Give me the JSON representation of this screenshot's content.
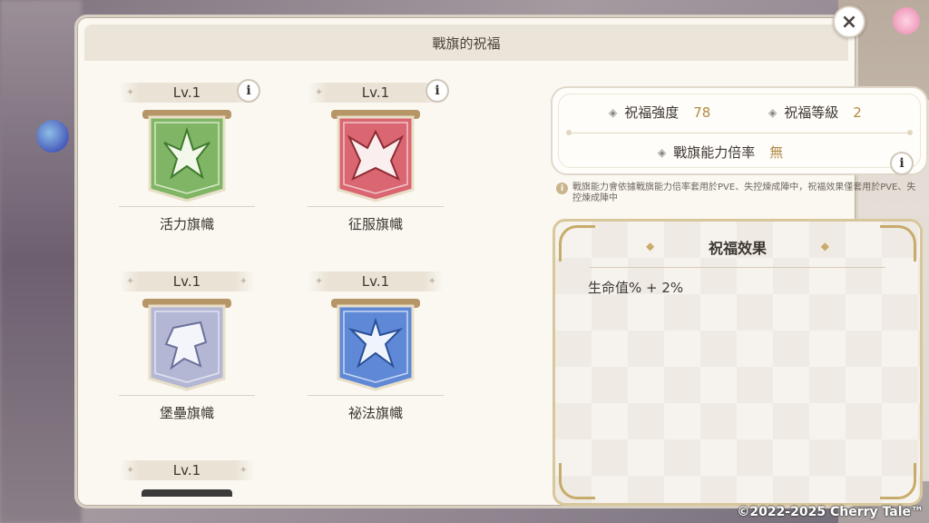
{
  "panel": {
    "title": "戰旗的祝福",
    "close_label": "×"
  },
  "banners": [
    {
      "level": "Lv.1",
      "name": "活力旗幟",
      "color": "#6aa04f",
      "emblem": "leaf-emblem-icon"
    },
    {
      "level": "Lv.1",
      "name": "征服旗幟",
      "color": "#c8505a",
      "emblem": "dragon-emblem-icon"
    },
    {
      "level": "Lv.1",
      "name": "堡壘旗幟",
      "color": "#9ea3c4",
      "emblem": "pegasus-emblem-icon"
    },
    {
      "level": "Lv.1",
      "name": "祕法旗幟",
      "color": "#4e77c4",
      "emblem": "phoenix-emblem-icon"
    },
    {
      "level": "Lv.1"
    }
  ],
  "info_label": "i",
  "stats": {
    "blessing_strength_label": "祝福強度",
    "blessing_strength_value": "78",
    "blessing_level_label": "祝福等級",
    "blessing_level_value": "2",
    "multiplier_label": "戰旗能力倍率",
    "multiplier_value": "無"
  },
  "note": {
    "icon": "i",
    "text": "戰旗能力會依據戰旗能力倍率套用於PVE、失控煉成陣中，祝福效果僅套用於PVE、失控煉成陣中"
  },
  "effect": {
    "title": "祝福效果",
    "text": "生命值% + 2%"
  },
  "copyright": "©2022-2025 Cherry Tale™",
  "colors": {
    "accent_gold": "#b08a46",
    "frame_gold": "#d9c79c",
    "panel_bg": "#fbf8f2"
  }
}
